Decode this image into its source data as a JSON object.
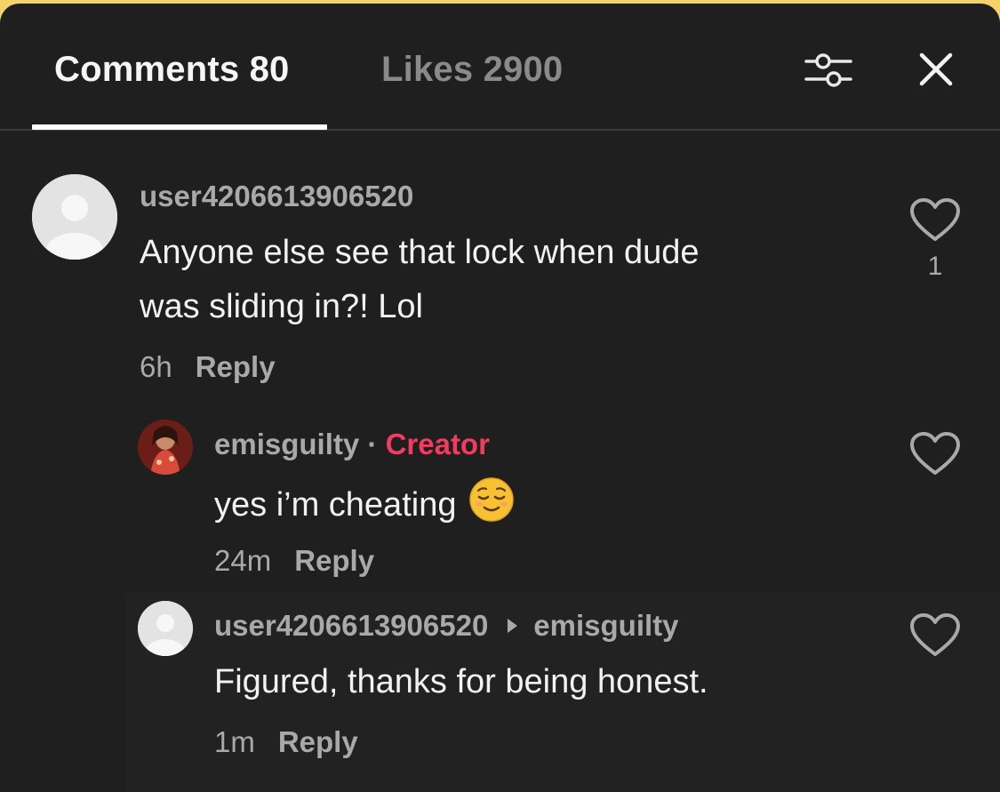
{
  "tabs": {
    "comments": "Comments 80",
    "likes": "Likes 2900"
  },
  "icons": {
    "filter": "sliders-icon",
    "close": "close-icon",
    "like": "heart-outline-icon",
    "emoji": "relieved-face-emoji"
  },
  "colors": {
    "creator_badge": "#ee3d5e",
    "panel_background": "#1f1f1f"
  },
  "comments": [
    {
      "username": "user4206613906520",
      "text_line1": "Anyone else see that lock when dude",
      "text_line2": "was sliding in?! Lol",
      "time": "6h",
      "reply_label": "Reply",
      "like_count": "1"
    },
    {
      "username": "emisguilty",
      "badge_separator": "·",
      "badge": "Creator",
      "text": "yes i’m cheating",
      "emoji": "😌",
      "time": "24m",
      "reply_label": "Reply"
    },
    {
      "username": "user4206613906520",
      "reply_to": "emisguilty",
      "text": "Figured, thanks for being honest.",
      "time": "1m",
      "reply_label": "Reply"
    }
  ]
}
